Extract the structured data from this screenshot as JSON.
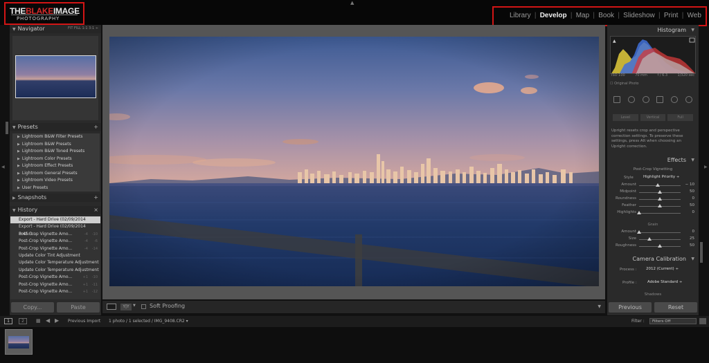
{
  "branding": {
    "logo_prefix": "THE",
    "logo_accent": "BLAKE",
    "logo_suffix": "IMAGE",
    "logo_sub": "PHOTOGRAPHY"
  },
  "modules": [
    {
      "label": "Library",
      "active": false
    },
    {
      "label": "Develop",
      "active": true
    },
    {
      "label": "Map",
      "active": false
    },
    {
      "label": "Book",
      "active": false
    },
    {
      "label": "Slideshow",
      "active": false
    },
    {
      "label": "Print",
      "active": false
    },
    {
      "label": "Web",
      "active": false
    }
  ],
  "left_panel": {
    "navigator": {
      "title": "Navigator",
      "options": "FIT  FILL  1:1  3:1 ÷"
    },
    "presets": {
      "title": "Presets",
      "items": [
        "Lightroom B&W Filter Presets",
        "Lightroom B&W Presets",
        "Lightroom B&W Toned Presets",
        "Lightroom Color Presets",
        "Lightroom Effect Presets",
        "Lightroom General Presets",
        "Lightroom Video Presets",
        "User Presets"
      ]
    },
    "snapshots": {
      "title": "Snapshots"
    },
    "history": {
      "title": "History",
      "items": [
        {
          "label": "Export - Hard Drive (02/09/2014 8:46:4...",
          "v1": "",
          "v2": "",
          "selected": true
        },
        {
          "label": "Export - Hard Drive (02/09/2014 8:45:3...",
          "v1": "",
          "v2": "",
          "selected": false
        },
        {
          "label": "Post-Crop Vignette Amo...",
          "v1": "-4",
          "v2": "-10",
          "selected": false
        },
        {
          "label": "Post-Crop Vignette Amo...",
          "v1": "-4",
          "v2": "-6",
          "selected": false
        },
        {
          "label": "Post-Crop Vignette Amo...",
          "v1": "-4",
          "v2": "-14",
          "selected": false
        },
        {
          "label": "Update Color Tint Adjustment",
          "v1": "",
          "v2": "",
          "selected": false
        },
        {
          "label": "Update Color Temperature Adjustment",
          "v1": "",
          "v2": "",
          "selected": false
        },
        {
          "label": "Update Color Temperature Adjustment",
          "v1": "",
          "v2": "",
          "selected": false
        },
        {
          "label": "Post-Crop Vignette Amo...",
          "v1": "+1",
          "v2": "-10",
          "selected": false
        },
        {
          "label": "Post-Crop Vignette Amo...",
          "v1": "+1",
          "v2": "-11",
          "selected": false
        },
        {
          "label": "Post-Crop Vignette Amo...",
          "v1": "+1",
          "v2": "-12",
          "selected": false
        }
      ]
    },
    "copy_label": "Copy...",
    "paste_label": "Paste"
  },
  "toolbar": {
    "yy_label": "Y|Y",
    "soft_proofing_label": "Soft Proofing"
  },
  "right_panel": {
    "histogram": {
      "title": "Histogram",
      "iso": "ISO 100",
      "focal": "70 mm",
      "aperture": "f / 6.3",
      "shutter": "1/320 sec",
      "original_photo": "Original Photo"
    },
    "upright": {
      "buttons_row2": [
        "Level",
        "Vertical",
        "Full"
      ],
      "text": "Upright resets crop and perspective correction settings. To preserve these settings, press Alt when choosing an Upright correction."
    },
    "effects": {
      "title": "Effects",
      "vignette_title": "Post-Crop Vignetting",
      "style_label": "Style",
      "style_value": "Highlight Priority ÷",
      "sliders": [
        {
          "label": "Amount",
          "value": "− 10",
          "pos": 0.45
        },
        {
          "label": "Midpoint",
          "value": "50",
          "pos": 0.5
        },
        {
          "label": "Roundness",
          "value": "0",
          "pos": 0.5
        },
        {
          "label": "Feather",
          "value": "50",
          "pos": 0.5
        },
        {
          "label": "Highlights",
          "value": "0",
          "pos": 0.0
        }
      ],
      "grain_title": "Grain",
      "grain_sliders": [
        {
          "label": "Amount",
          "value": "0",
          "pos": 0.0
        },
        {
          "label": "Size",
          "value": "25",
          "pos": 0.25
        },
        {
          "label": "Roughness",
          "value": "50",
          "pos": 0.5
        }
      ]
    },
    "calibration": {
      "title": "Camera Calibration",
      "process_label": "Process :",
      "process_value": "2012 (Current) ÷",
      "profile_label": "Profile :",
      "profile_value": "Adobe Standard ÷",
      "shadows_label": "Shadows"
    },
    "previous_label": "Previous",
    "reset_label": "Reset"
  },
  "filmstrip": {
    "view1": "1",
    "view2": "2",
    "source": "Previous Import",
    "count": "1 photo / 1 selected / IMG_9408.CR2 ▾",
    "filter_label": "Filter :",
    "filter_value": "Filters Off"
  },
  "colors": {
    "highlight_box": "#d31515",
    "panel_bg": "#2a2a2a",
    "center_bg": "#555555"
  }
}
